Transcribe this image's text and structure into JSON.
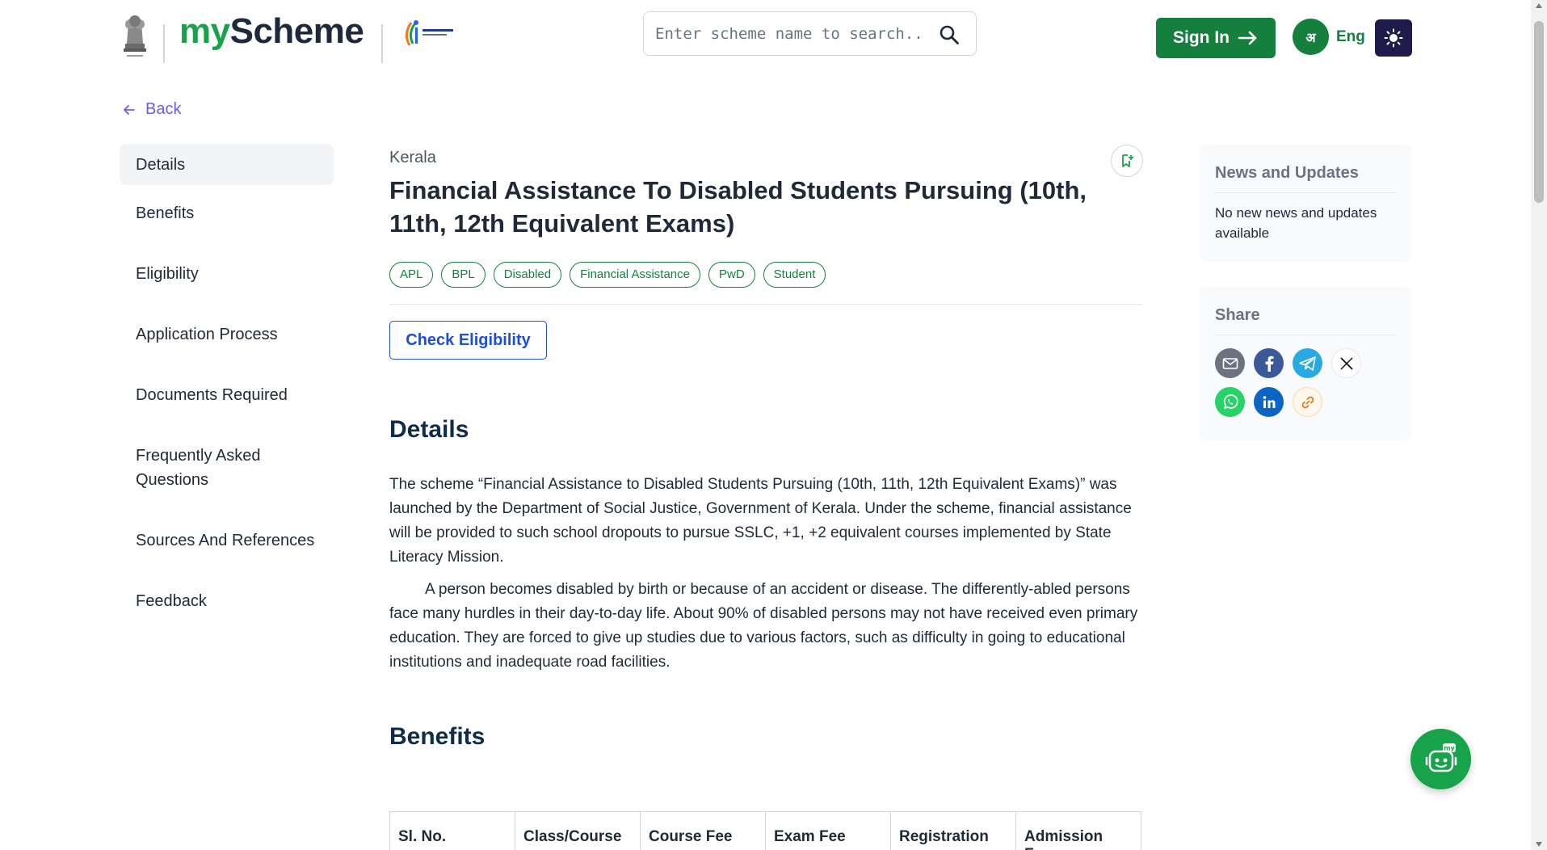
{
  "header": {
    "brand_my": "my",
    "brand_scheme": "Scheme",
    "search_placeholder": "Enter scheme name to search...",
    "signin_label": "Sign In",
    "lang_icon_text": "अ",
    "lang_label": "Eng"
  },
  "back_label": "Back",
  "sidebar": {
    "items": [
      {
        "label": "Details"
      },
      {
        "label": "Benefits"
      },
      {
        "label": "Eligibility"
      },
      {
        "label": "Application Process"
      },
      {
        "label": "Documents Required"
      },
      {
        "label": "Frequently Asked Questions"
      },
      {
        "label": "Sources And References"
      },
      {
        "label": "Feedback"
      }
    ]
  },
  "scheme": {
    "state": "Kerala",
    "title": "Financial Assistance To Disabled Students Pursuing (10th, 11th, 12th Equivalent Exams)",
    "tags": [
      "APL",
      "BPL",
      "Disabled",
      "Financial Assistance",
      "PwD",
      "Student"
    ],
    "check_eligibility": "Check Eligibility"
  },
  "details": {
    "heading": "Details",
    "para1": "The scheme “Financial Assistance to Disabled Students Pursuing (10th, 11th, 12th Equivalent Exams)” was launched by the Department of Social Justice, Government of Kerala. Under the scheme, financial assistance will be provided to such school dropouts to pursue SSLC, +1, +2 equivalent courses implemented by State Literacy Mission.",
    "para2": "A person becomes disabled by birth or because of an accident or disease. The differently-abled persons face many hurdles in their day-to-day life. About 90% of disabled persons may not have received even primary education. They are forced to give up studies due to various factors, such as difficulty in going to educational institutions and inadequate road facilities."
  },
  "benefits": {
    "heading": "Benefits",
    "table_headers": [
      "Sl. No.",
      "Class/Course",
      "Course Fee",
      "Exam Fee",
      "Registration",
      "Admission Fee"
    ]
  },
  "news": {
    "title": "News and Updates",
    "text": "No new news and updates available"
  },
  "share": {
    "title": "Share",
    "icons": [
      "email-icon",
      "facebook-icon",
      "telegram-icon",
      "x-icon",
      "whatsapp-icon",
      "linkedin-icon",
      "link-icon"
    ]
  },
  "colors": {
    "brand_green": "#15803d",
    "accent_purple": "#6d5ce7",
    "link_blue": "#1d4ed8",
    "heading_navy": "#0f2d4a"
  }
}
